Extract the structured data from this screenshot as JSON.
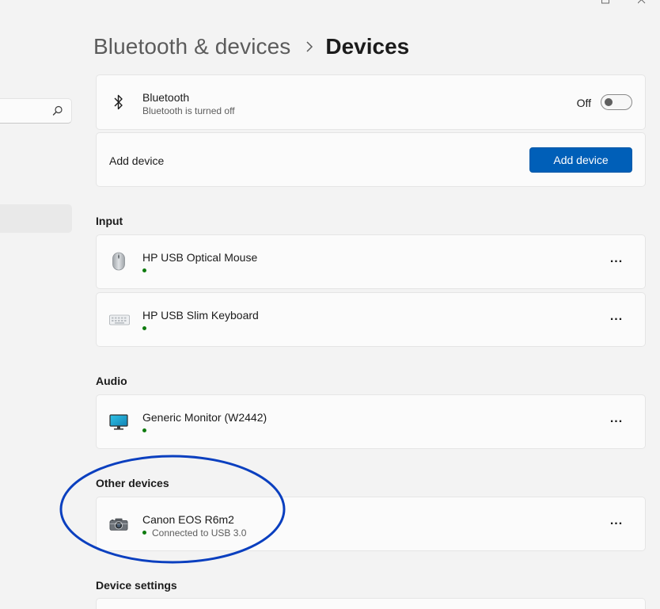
{
  "header": {
    "parent": "Bluetooth & devices",
    "current": "Devices"
  },
  "search": {
    "value": "",
    "placeholder": ""
  },
  "bluetooth": {
    "title": "Bluetooth",
    "subtitle": "Bluetooth is turned off",
    "toggle_label": "Off",
    "toggle_on": false,
    "icon": "bluetooth-icon"
  },
  "add_device": {
    "label": "Add device",
    "button_label": "Add device"
  },
  "sections": {
    "input": "Input",
    "audio": "Audio",
    "other": "Other devices",
    "settings": "Device settings"
  },
  "devices": {
    "mouse": {
      "name": "HP USB Optical Mouse",
      "status": "",
      "icon": "mouse-icon"
    },
    "keyboard": {
      "name": "HP USB Slim Keyboard",
      "status": "",
      "icon": "keyboard-icon"
    },
    "monitor": {
      "name": "Generic Monitor (W2442)",
      "status": "",
      "icon": "monitor-icon"
    },
    "camera": {
      "name": "Canon EOS R6m2",
      "status": "Connected to USB 3.0",
      "icon": "camera-icon"
    }
  },
  "more_label": "...",
  "colors": {
    "accent": "#005fb8",
    "status_connected": "#0f7b0f",
    "annotation": "#0a3fbf",
    "background": "#f3f3f3",
    "card": "#fbfbfb"
  }
}
